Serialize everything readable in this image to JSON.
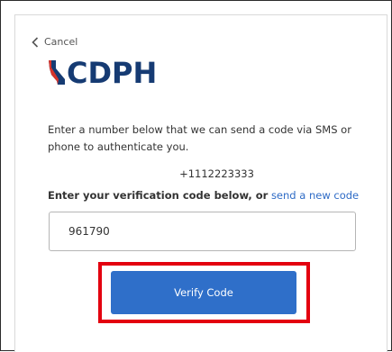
{
  "nav": {
    "cancel_label": "Cancel"
  },
  "logo": {
    "text": "CDPH",
    "icon": "california-state-icon"
  },
  "content": {
    "intro_text": "Enter a number below that we can send a code via SMS or phone to authenticate you.",
    "phone_number": "+1112223333",
    "prompt_text": "Enter your verification code below, or",
    "resend_link_label": "send a new code"
  },
  "form": {
    "code_value": "961790",
    "verify_button_label": "Verify Code"
  },
  "colors": {
    "brand_navy": "#163b73",
    "brand_red": "#d6342b",
    "link_blue": "#2e6bc6",
    "button_blue": "#2f6fc9",
    "highlight_red": "#e3000f"
  }
}
